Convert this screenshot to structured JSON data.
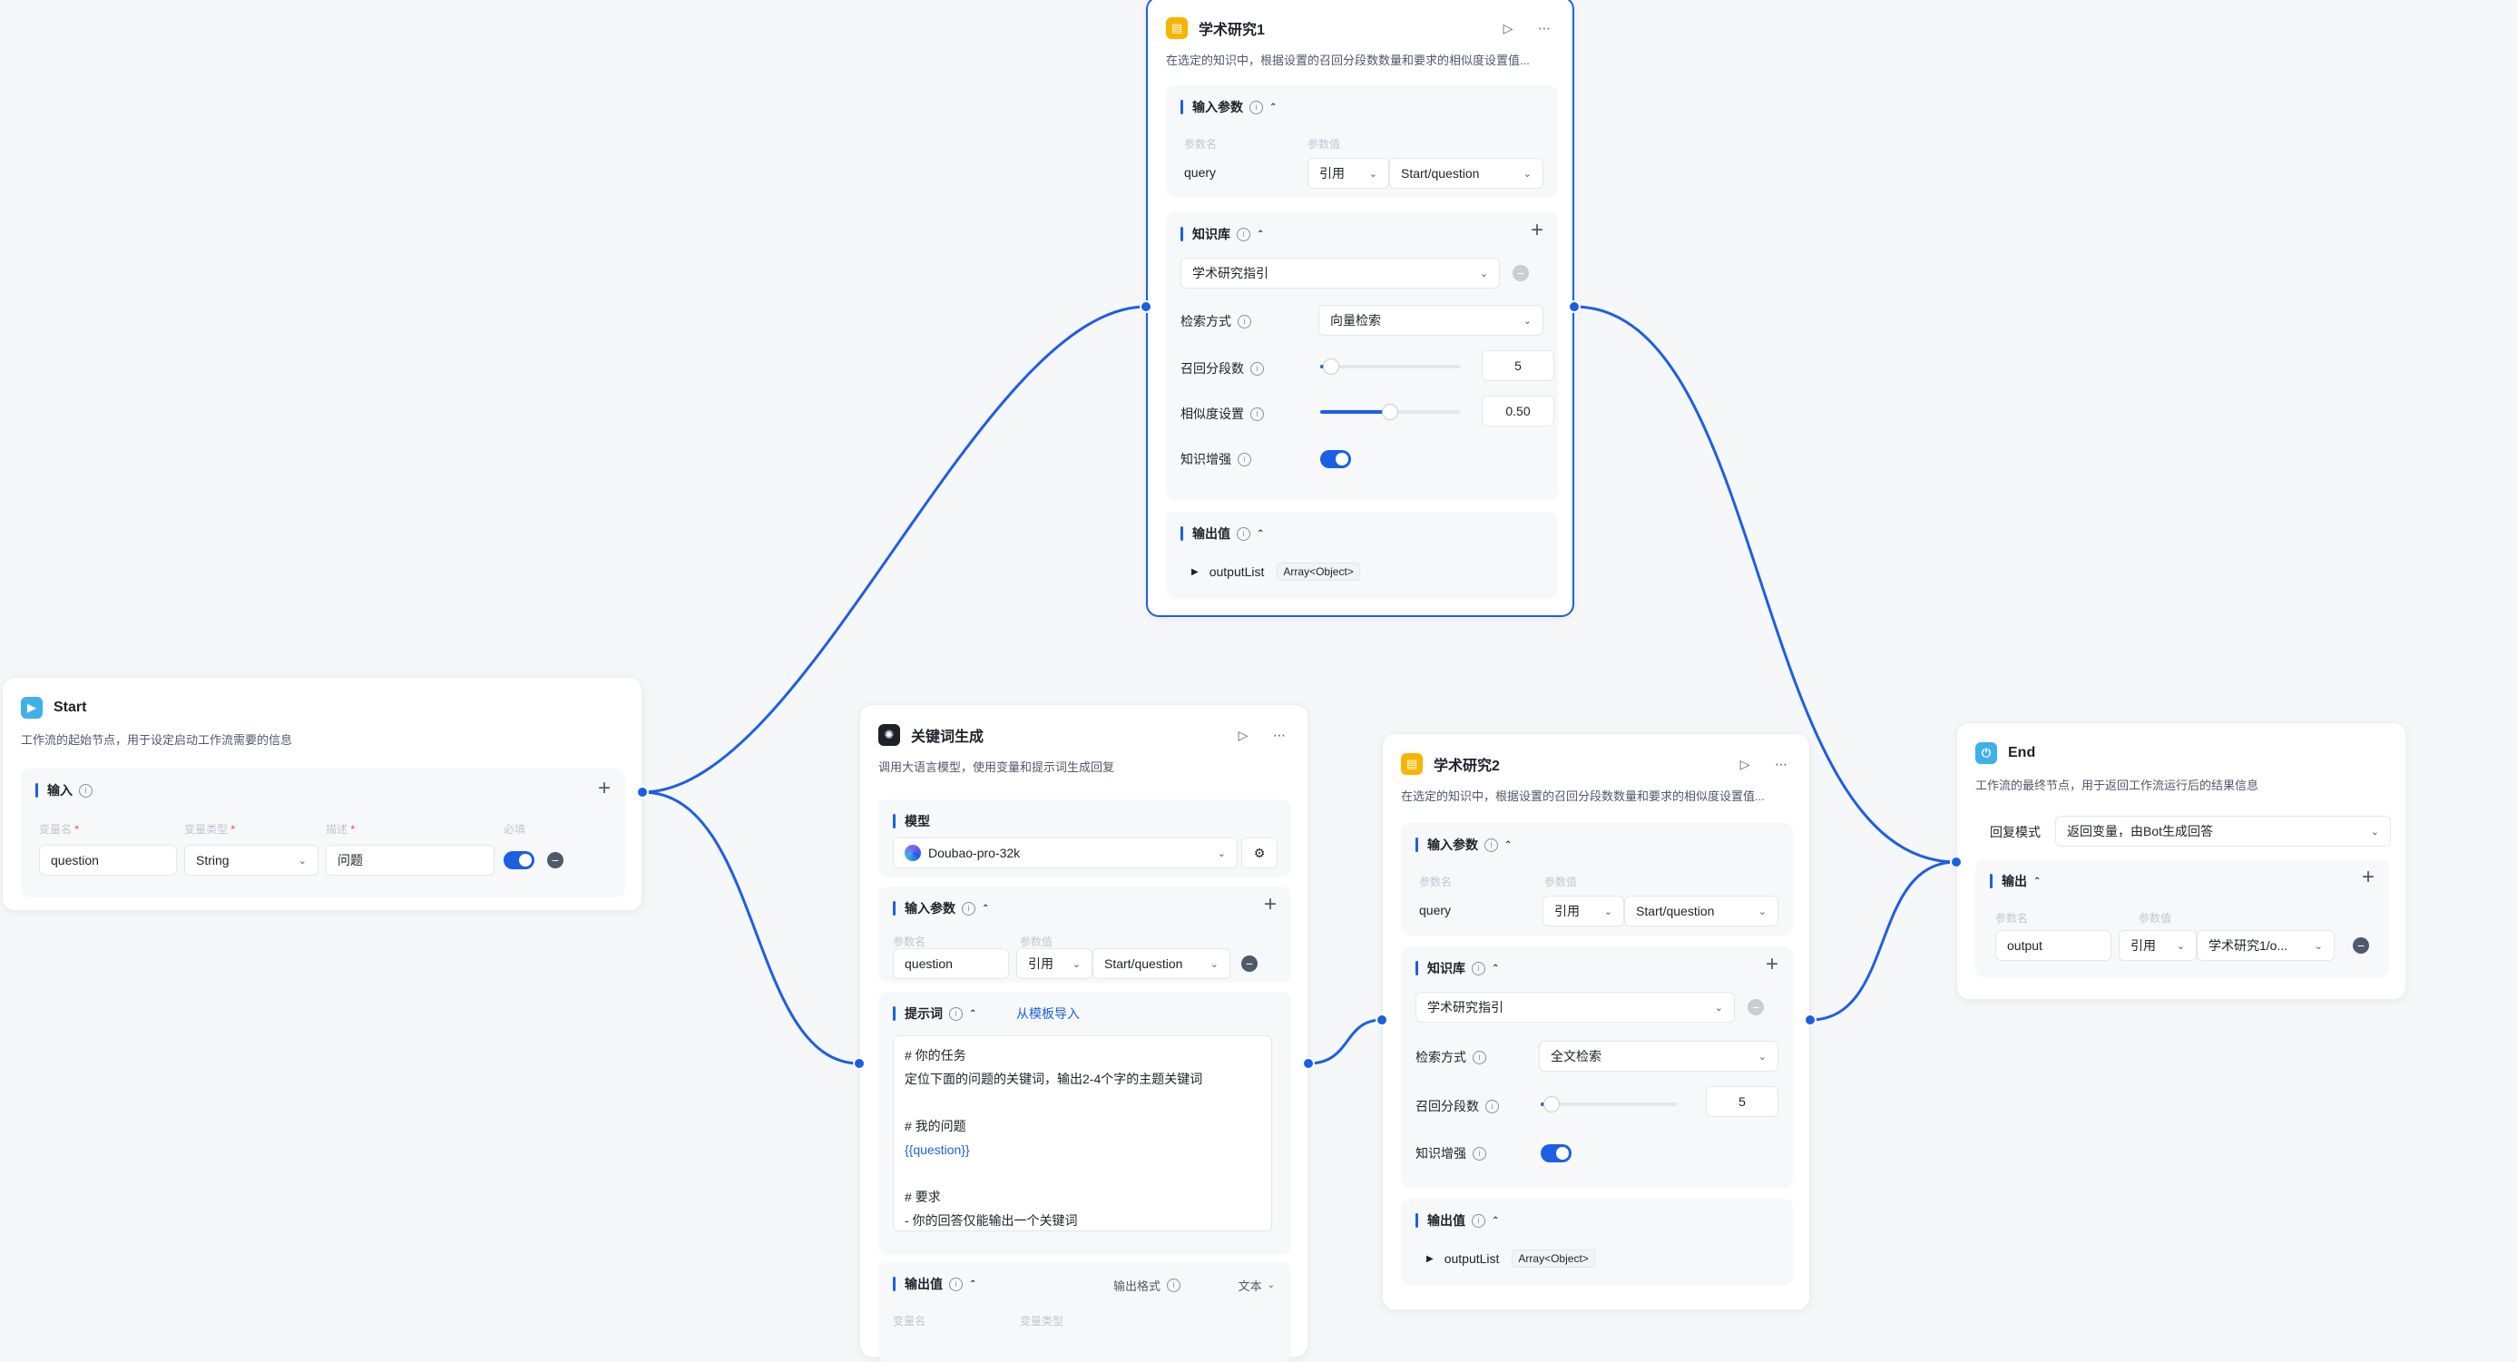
{
  "colors": {
    "accent": "#1d5fe3",
    "start_icon": "#3fb0e8",
    "knowledge_icon": "#f7b500",
    "llm_icon": "#1d2129",
    "end_icon": "#3fb0e8"
  },
  "start": {
    "title": "Start",
    "desc": "工作流的起始节点，用于设定启动工作流需要的信息",
    "input_title": "输入",
    "cols": {
      "name": "变量名",
      "type": "变量类型",
      "desc": "描述",
      "required": "必填"
    },
    "row": {
      "name": "question",
      "type": "String",
      "desc": "问题"
    }
  },
  "ks1": {
    "title": "学术研究1",
    "desc": "在选定的知识中，根据设置的召回分段数数量和要求的相似度设置值...",
    "input_title": "输入参数",
    "cols": {
      "name": "参数名",
      "value": "参数值"
    },
    "param": {
      "name": "query",
      "ref": "引用",
      "value": "Start/question"
    },
    "kb_title": "知识库",
    "kb_item": "学术研究指引",
    "search_label": "检索方式",
    "search_value": "向量检索",
    "recall_label": "召回分段数",
    "recall_value": "5",
    "recall_level": 0.08,
    "sim_label": "相似度设置",
    "sim_value": "0.50",
    "sim_level": 0.5,
    "enhance_label": "知识增强",
    "output_title": "输出值",
    "output_name": "outputList",
    "output_type": "Array<Object>"
  },
  "llm": {
    "title": "关键词生成",
    "desc": "调用大语言模型，使用变量和提示词生成回复",
    "model_title": "模型",
    "model_value": "Doubao-pro-32k",
    "input_title": "输入参数",
    "cols": {
      "name": "参数名",
      "value": "参数值"
    },
    "param": {
      "name": "question",
      "ref": "引用",
      "value": "Start/question"
    },
    "prompt_title": "提示词",
    "prompt_link": "从模板导入",
    "prompt_lines": [
      "# 你的任务",
      "定位下面的问题的关键词，输出2-4个字的主题关键词",
      "",
      "# 我的问题",
      "{{question}}",
      "",
      "# 要求",
      "- 你的回答仅能输出一个关键词"
    ],
    "output_title": "输出值",
    "output_format_label": "输出格式",
    "output_format_value": "文本",
    "out_cols": {
      "name": "变量名",
      "type": "变量类型"
    }
  },
  "ks2": {
    "title": "学术研究2",
    "desc": "在选定的知识中，根据设置的召回分段数数量和要求的相似度设置值...",
    "input_title": "输入参数",
    "cols": {
      "name": "参数名",
      "value": "参数值"
    },
    "param": {
      "name": "query",
      "ref": "引用",
      "value": "Start/question"
    },
    "kb_title": "知识库",
    "kb_item": "学术研究指引",
    "search_label": "检索方式",
    "search_value": "全文检索",
    "recall_label": "召回分段数",
    "recall_value": "5",
    "recall_level": 0.08,
    "enhance_label": "知识增强",
    "output_title": "输出值",
    "output_name": "outputList",
    "output_type": "Array<Object>"
  },
  "end": {
    "title": "End",
    "desc": "工作流的最终节点，用于返回工作流运行后的结果信息",
    "mode_label": "回复模式",
    "mode_value": "返回变量，由Bot生成回答",
    "output_title": "输出",
    "cols": {
      "name": "参数名",
      "value": "参数值"
    },
    "param": {
      "name": "output",
      "ref": "引用",
      "value": "学术研究1/o..."
    }
  }
}
